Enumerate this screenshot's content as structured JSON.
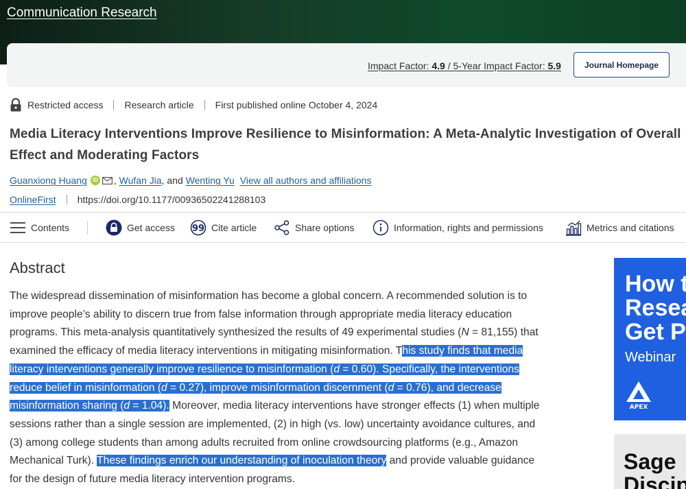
{
  "header": {
    "journal_title": "Communication Research",
    "impact_factor_label": "Impact Factor:",
    "impact_factor_value": "4.9",
    "slash": "/",
    "five_year_label": "5-Year Impact Factor:",
    "five_year_value": "5.9",
    "journal_homepage_button": "Journal Homepage"
  },
  "meta": {
    "access": "Restricted access",
    "type": "Research article",
    "published": "First published online October 4, 2024"
  },
  "article": {
    "title": "Media Literacy Interventions Improve Resilience to Misinformation: A Meta-Analytic Investigation of Overall Effect and Moderating Factors",
    "authors": {
      "author1": "Guanxiong Huang",
      "orcid_badge": "iD",
      "comma1": ",",
      "author2": "Wufan Jia",
      "and_text": ", and",
      "author3": "Wenting Yu",
      "view_all": "View all authors and affiliations"
    },
    "online_first": "OnlineFirst",
    "doi": "https://doi.org/10.1177/00936502241288103"
  },
  "toolbar": {
    "contents": "Contents",
    "get_access": "Get access",
    "cite": "Cite article",
    "share": "Share options",
    "info": "Information, rights and permissions",
    "metrics": "Metrics and citations"
  },
  "abstract": {
    "heading": "Abstract",
    "p1": "The widespread dissemination of misinformation has become a global concern. A recommended solution is to improve people’s ability to discern true from false information through appropriate media literacy education programs. This meta-analysis quantitatively synthesized the results of 49 experimental studies (",
    "n_italic": "N",
    "p2": " = 81,155) that examined the efficacy of media literacy interventions in mitigating misinformation. T",
    "hl1_a": "his study finds that media literacy interventions generally improve resilience to misinformation (",
    "d": "d",
    "hl1_b": " = 0.60). Specifically, the interventions reduce belief in misinformation (",
    "hl1_c": " = 0.27), improve misinformation discernment (",
    "hl1_d": " = 0.76), and decrease misinformation sharing (",
    "hl1_e": " = 1.04).",
    "p3": " Moreover, media literacy interventions have stronger effects (1) when multiple sessions rather than a single session are implemented, (2) in high (vs. low) uncertainty avoidance cultures, and (3) among college students than among adults recruited from online crowdsourcing platforms (e.g., Amazon Mechanical Turk). ",
    "hl2": "These findings enrich our understanding of inoculation theory",
    "p4": " and provide valuable guidance for the design of future media literacy intervention programs."
  },
  "ads": {
    "ad1_line1": "How t",
    "ad1_line2": "Resea",
    "ad1_line3": "Get P",
    "ad1_line4": "Webinar",
    "ad1_logo": "APEX",
    "ad2_line1": "Sage",
    "ad2_line2": "Discip"
  },
  "colors": {
    "header_green": "#0f4a2c",
    "link_blue": "#1f5f9e",
    "highlight_blue": "#2a6fcf",
    "ad_blue": "#1f60e0"
  }
}
